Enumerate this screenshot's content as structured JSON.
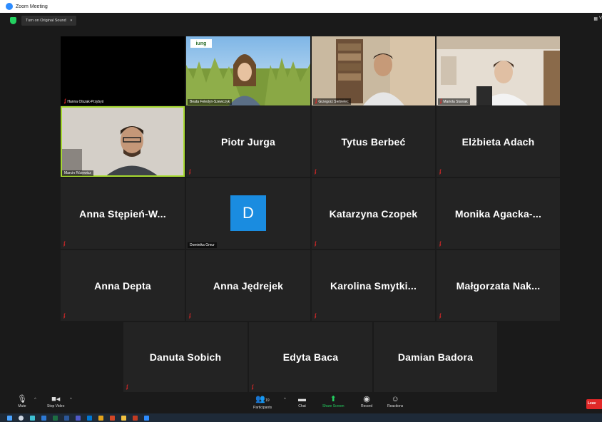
{
  "window": {
    "title": "Zoom Meeting"
  },
  "topbar": {
    "original_sound_label": "Turn on Original Sound",
    "view_label": "V"
  },
  "participants": {
    "row1": [
      {
        "caption": "Hanna Olszak-Przybyś",
        "muted": true,
        "kind": "black"
      },
      {
        "caption": "Beata Feledyn-Szewczyk",
        "muted": false,
        "kind": "video-field",
        "logo": "iung"
      },
      {
        "caption": "Grzegorz Siebielec",
        "muted": true,
        "kind": "video-office"
      },
      {
        "caption": "Mariola Staniak",
        "muted": true,
        "kind": "video-room"
      }
    ],
    "row2": [
      {
        "caption": "Marcin Różewicz",
        "muted": false,
        "kind": "video-man",
        "highlight": true
      },
      {
        "name": "Piotr Jurga",
        "muted": true
      },
      {
        "name": "Tytus Berbeć",
        "muted": true
      },
      {
        "name": "Elżbieta Adach",
        "muted": true
      }
    ],
    "row3": [
      {
        "name": "Anna  Stępień-W...",
        "muted": true
      },
      {
        "caption": "Dominika Gmur",
        "initial": "D",
        "muted": false
      },
      {
        "name": "Katarzyna Czopek",
        "muted": true
      },
      {
        "name": "Monika  Agacka-...",
        "muted": true
      }
    ],
    "row4": [
      {
        "name": "Anna Depta",
        "muted": true
      },
      {
        "name": "Anna Jędrejek",
        "muted": true
      },
      {
        "name": "Karolina  Smytki...",
        "muted": true
      },
      {
        "name": "Małgorzata  Nak...",
        "muted": true
      }
    ],
    "row5": [
      {
        "name": "Danuta Sobich",
        "muted": true
      },
      {
        "name": "Edyta Baca",
        "muted": true
      },
      {
        "name": "Damian Badora",
        "muted": false
      }
    ]
  },
  "toolbar": {
    "mute_label": "Mute",
    "stop_video_label": "Stop Video",
    "participants_label": "Participants",
    "participants_count": "19",
    "chat_label": "Chat",
    "share_screen_label": "Share Screen",
    "record_label": "Record",
    "reactions_label": "Reactions",
    "leave_label": "Leav"
  },
  "icons": {
    "mute": "microphone-icon",
    "video": "camera-icon",
    "participants": "people-icon",
    "chat": "chat-bubble-icon",
    "share": "share-arrow-icon",
    "record": "record-dot-icon",
    "reactions": "smiley-icon",
    "muted_indicator": "muted-mic-icon"
  },
  "colors": {
    "accent_green": "#23d160",
    "active_speaker": "#a6d930",
    "muted_red": "#e02828",
    "avatar_blue": "#1a8ce0"
  }
}
